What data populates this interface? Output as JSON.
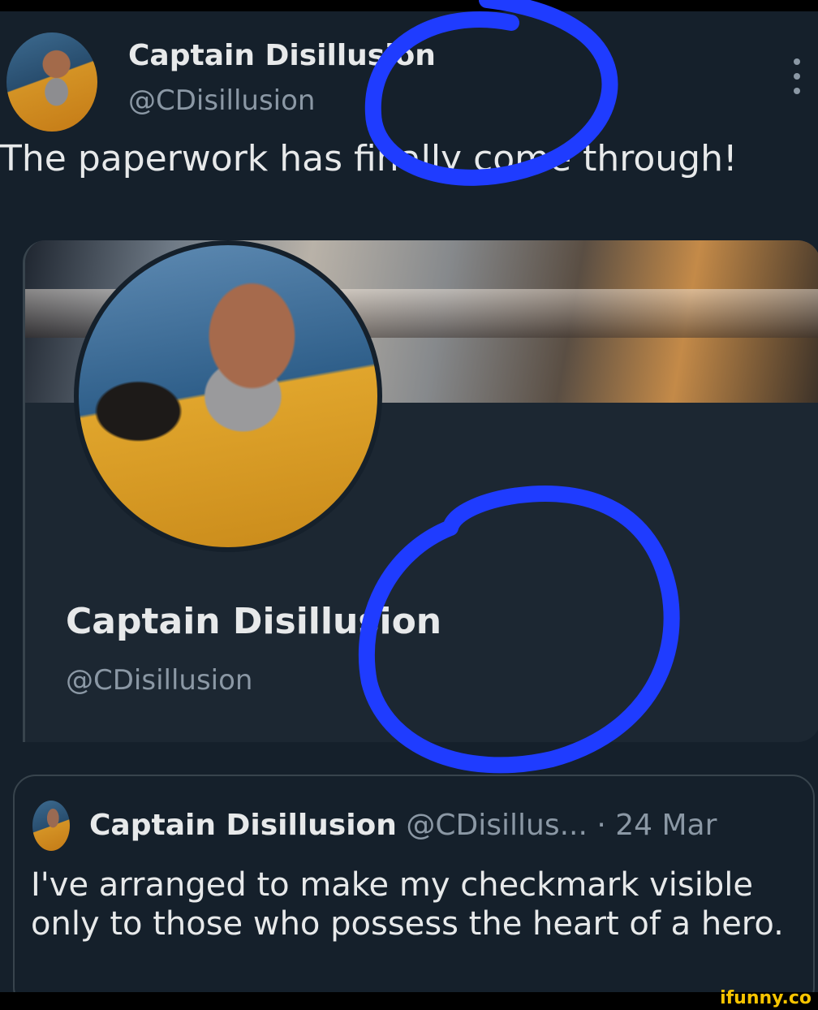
{
  "header": {
    "name": "Captain Disillusion",
    "handle": "@CDisillusion",
    "more_icon": "kebab-menu-icon"
  },
  "tweet": {
    "text": "The paperwork has finally come through!"
  },
  "profile_card": {
    "name": "Captain Disillusion",
    "handle": "@CDisillusion"
  },
  "quoted_tweet": {
    "name": "Captain Disillusion",
    "handle": "@CDisillus...",
    "date": "· 24 Mar",
    "text": "I've arranged to make my checkmark visible only to those who possess the heart of a hero."
  },
  "annotations": {
    "circle_color": "#1f3cff"
  },
  "watermark": "ifunny.co"
}
